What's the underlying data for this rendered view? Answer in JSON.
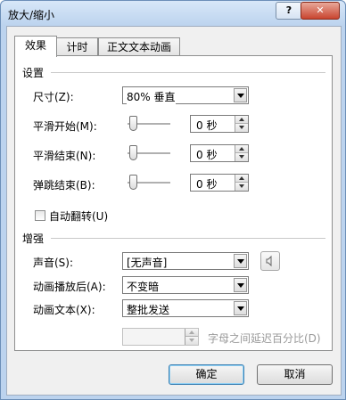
{
  "window": {
    "title": "放大/缩小",
    "help_label": "?",
    "close_label": "✕"
  },
  "tabs": [
    {
      "label": "效果",
      "active": true
    },
    {
      "label": "计时",
      "active": false
    },
    {
      "label": "正文文本动画",
      "active": false
    }
  ],
  "settings": {
    "group_label": "设置",
    "size": {
      "label": "尺寸(Z):",
      "value": "80% 垂直"
    },
    "smooth_start": {
      "label": "平滑开始(M):",
      "value": "0 秒"
    },
    "smooth_end": {
      "label": "平滑结束(N):",
      "value": "0 秒"
    },
    "bounce_end": {
      "label": "弹跳结束(B):",
      "value": "0 秒"
    },
    "auto_reverse": {
      "label": "自动翻转(U)",
      "checked": false
    }
  },
  "enhance": {
    "group_label": "增强",
    "sound": {
      "label": "声音(S):",
      "value": "[无声音]"
    },
    "after_animation": {
      "label": "动画播放后(A):",
      "value": "不变暗"
    },
    "animate_text": {
      "label": "动画文本(X):",
      "value": "整批发送"
    },
    "delay": {
      "value": "",
      "label": "字母之间延迟百分比(D)"
    }
  },
  "footer": {
    "ok_label": "确定",
    "cancel_label": "取消"
  }
}
